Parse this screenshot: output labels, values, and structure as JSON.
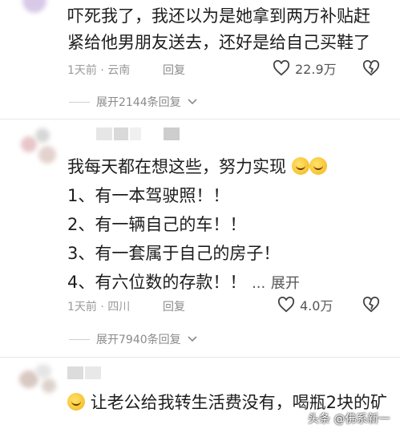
{
  "comments": [
    {
      "lines": [
        "吓死我了，我还以为是她拿到两万补贴赶",
        "紧给他男朋友送去，还好是给自己买鞋了"
      ],
      "meta": "1天前 · 云南",
      "reply_label": "回复",
      "likes": "22.9万",
      "expand_label": "展开2144条回复"
    },
    {
      "lines": [
        "我每天都在想这些，努力实现",
        "1、有一本驾驶照！！",
        "2、有一辆自己的车！！",
        "3、有一套属于自己的房子！",
        "4、有六位数的存款！！"
      ],
      "ellipsis": "...",
      "inline_expand": "展开",
      "meta": "1天前 · 四川",
      "reply_label": "回复",
      "likes": "4.0万",
      "expand_label": "展开7940条回复"
    },
    {
      "lines": [
        "让老公给我转生活费没有，喝瓶2块的矿"
      ]
    }
  ],
  "watermark": "头条 @佛系新一",
  "icons": {
    "like": "heart-outline-icon",
    "dislike": "heart-broken-icon",
    "expand": "chevron-down-icon",
    "laugh": "laughing-tears-emoji",
    "smile": "smile-emoji"
  }
}
